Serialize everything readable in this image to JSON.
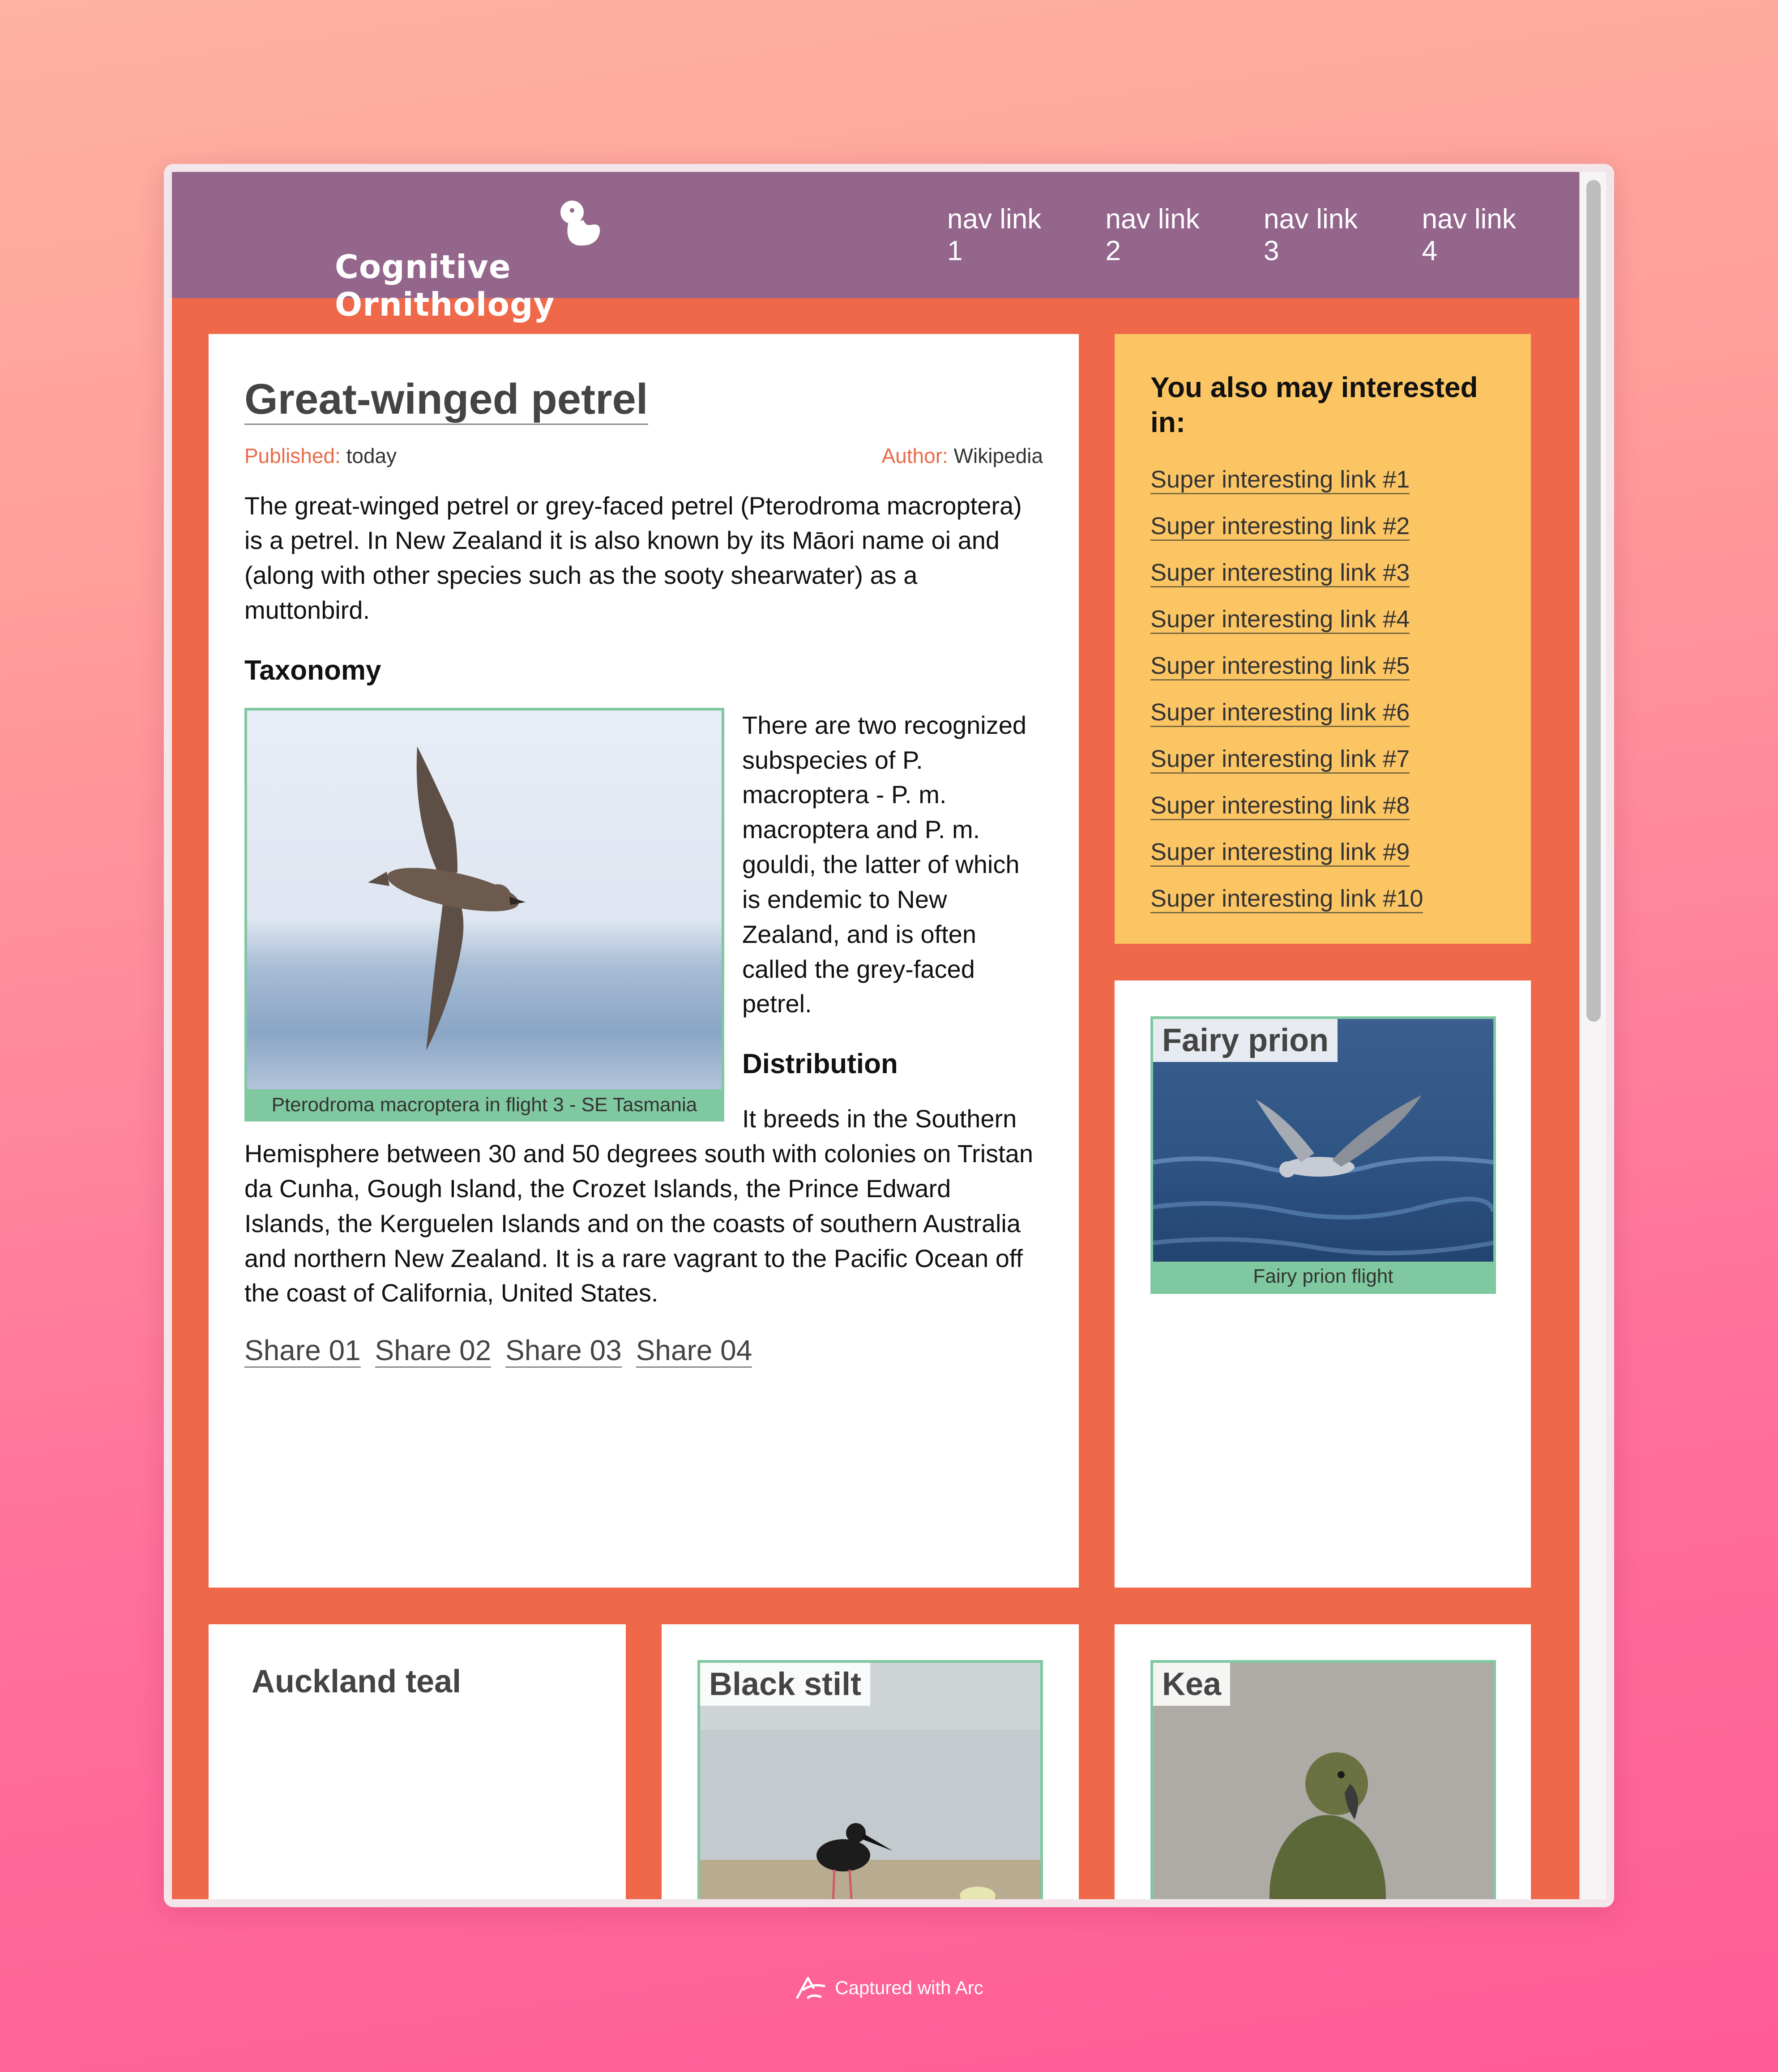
{
  "header": {
    "logo_text": "Cognitive Ornithology",
    "nav": [
      "nav link 1",
      "nav link 2",
      "nav link 3",
      "nav link 4"
    ]
  },
  "article": {
    "title": "Great-winged petrel",
    "published_label": "Published:",
    "published_value": "today",
    "author_label": "Author:",
    "author_value": "Wikipedia",
    "intro": "The great-winged petrel or grey-faced petrel (Pterodroma macroptera) is a petrel. In New Zealand it is also known by its Māori name oi and (along with other species such as the sooty shearwater) as a muttonbird.",
    "taxonomy_heading": "Taxonomy",
    "figure_caption": "Pterodroma macroptera in flight 3 - SE Tasmania",
    "taxonomy_text": "There are two recognized subspecies of P. macroptera - P. m. macroptera and P. m. gouldi, the latter of which is endemic to New Zealand, and is often called the grey-faced petrel.",
    "distribution_heading": "Distribution",
    "distribution_text": "It breeds in the Southern Hemisphere between 30 and 50 degrees south with colonies on Tristan da Cunha, Gough Island, the Crozet Islands, the Prince Edward Islands, the Kerguelen Islands and on the coasts of southern Australia and northern New Zealand. It is a rare vagrant to the Pacific Ocean off the coast of California, United States.",
    "share": [
      "Share 01",
      "Share 02",
      "Share 03",
      "Share 04"
    ]
  },
  "sidebar": {
    "heading": "You also may interested in:",
    "links": [
      "Super interesting link #1",
      "Super interesting link #2",
      "Super interesting link #3",
      "Super interesting link #4",
      "Super interesting link #5",
      "Super interesting link #6",
      "Super interesting link #7",
      "Super interesting link #8",
      "Super interesting link #9",
      "Super interesting link #10"
    ]
  },
  "cards": {
    "fairy_prion": {
      "title": "Fairy prion",
      "caption": "Fairy prion flight"
    },
    "auckland_teal": {
      "title": "Auckland teal"
    },
    "black_stilt": {
      "title": "Black stilt"
    },
    "kea": {
      "title": "Kea"
    }
  },
  "footer": {
    "capture_text": "Captured with Arc"
  },
  "colors": {
    "header": "#94668c",
    "page_background": "#ef684a",
    "sidebar_background": "#fcc563",
    "figure_border": "#7fc8a0",
    "meta_label": "#ea6a4a"
  }
}
